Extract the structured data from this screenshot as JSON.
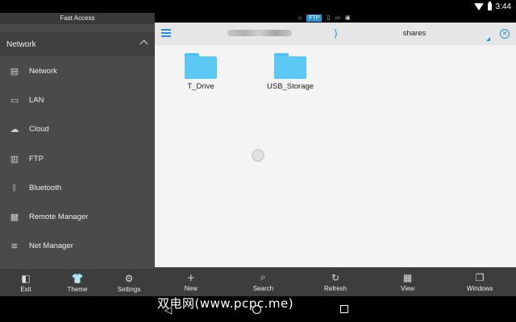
{
  "status": {
    "time": "3:44"
  },
  "sidebar": {
    "fast_access": "Fast Access",
    "section_title": "Network",
    "items": [
      {
        "label": "Network",
        "icon": "network-icon",
        "glyph": "▤"
      },
      {
        "label": "LAN",
        "icon": "lan-icon",
        "glyph": "▭"
      },
      {
        "label": "Cloud",
        "icon": "cloud-icon",
        "glyph": "☁"
      },
      {
        "label": "FTP",
        "icon": "ftp-icon",
        "glyph": "▥"
      },
      {
        "label": "Bluetooth",
        "icon": "bluetooth-icon",
        "glyph": "ᛒ"
      },
      {
        "label": "Remote Manager",
        "icon": "remote-manager-icon",
        "glyph": "▦"
      },
      {
        "label": "Net Manager",
        "icon": "wifi-icon",
        "glyph": "≋"
      }
    ],
    "bottom": [
      {
        "label": "Exit",
        "glyph": "◧"
      },
      {
        "label": "Theme",
        "glyph": "👕"
      },
      {
        "label": "Settings",
        "glyph": "⚙"
      }
    ]
  },
  "header": {
    "ftp_badge": "FTP",
    "separator": "⟩",
    "path": "shares",
    "close_glyph": "✕"
  },
  "folders": [
    {
      "name": "T_Drive"
    },
    {
      "name": "USB_Storage"
    }
  ],
  "toolbar": [
    {
      "label": "New",
      "glyph": "+"
    },
    {
      "label": "Search",
      "glyph": "⌕"
    },
    {
      "label": "Refresh",
      "glyph": "↻"
    },
    {
      "label": "View",
      "glyph": "▦"
    },
    {
      "label": "Windows",
      "glyph": "❐"
    }
  ],
  "navbar": {
    "back_glyph": "◁"
  },
  "watermark": "双电网(www.pcpc.me)",
  "colors": {
    "accent": "#2a8fd6",
    "folder": "#5bc8f5",
    "sidebar": "#4a4a4a"
  }
}
